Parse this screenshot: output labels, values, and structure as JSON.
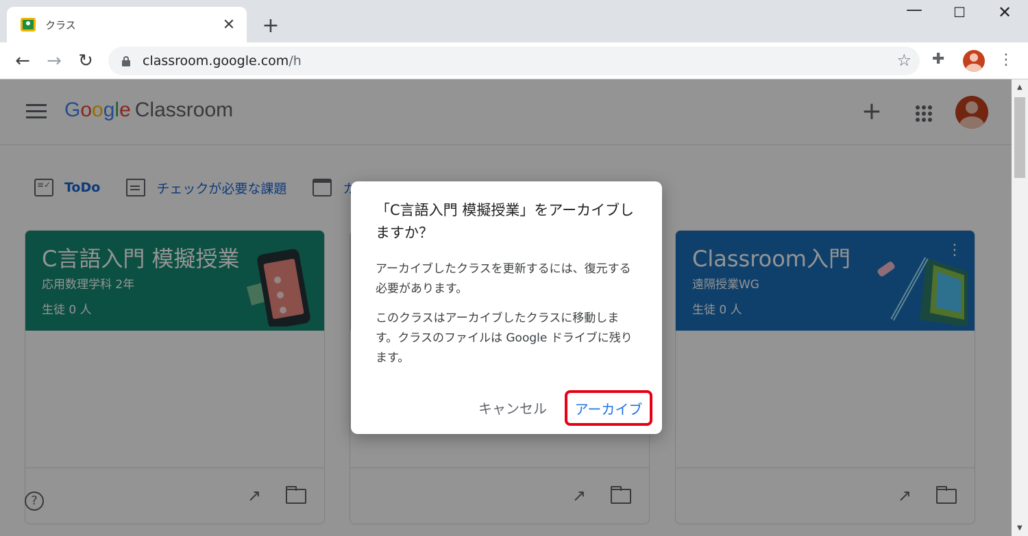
{
  "browser": {
    "tab_title": "クラス",
    "tab_close": "✕",
    "new_tab": "+",
    "window_min": "—",
    "window_max": "☐",
    "window_close": "✕",
    "url_host": "classroom.google.com",
    "url_path": "/h",
    "nav_back": "←",
    "nav_forward": "→",
    "nav_reload": "↻",
    "star": "☆",
    "extensions": "✚",
    "menu": "⋮"
  },
  "app": {
    "brand_letters": [
      "G",
      "o",
      "o",
      "g",
      "l",
      "e"
    ],
    "product": "Classroom",
    "create": "+",
    "quicklinks": [
      "ToDo",
      "チェックが必要な課題",
      "カレンダー"
    ],
    "help": "?"
  },
  "cards": [
    {
      "title": "C言語入門 模擬授業",
      "subtitle": "応用数理学科 2年",
      "count": "生徒 0 人"
    },
    {
      "title": "",
      "subtitle": "",
      "count": ""
    },
    {
      "title": "Classroom入門",
      "subtitle": "遠隔授業WG",
      "count": "生徒 0 人"
    }
  ],
  "card_menu": "⋮",
  "trend_icon": "↗",
  "dialog": {
    "title": "「C言語入門 模擬授業」をアーカイブしますか？",
    "body1": "アーカイブしたクラスを更新するには、復元する必要があります。",
    "body2": "このクラスはアーカイブしたクラスに移動します。クラスのファイルは Google ドライブに残ります。",
    "cancel": "キャンセル",
    "confirm": "アーカイブ"
  },
  "colors": {
    "card1": "#138a72",
    "card3": "#1a6fb8",
    "highlight": "#e60012",
    "link": "#1a73e8"
  }
}
